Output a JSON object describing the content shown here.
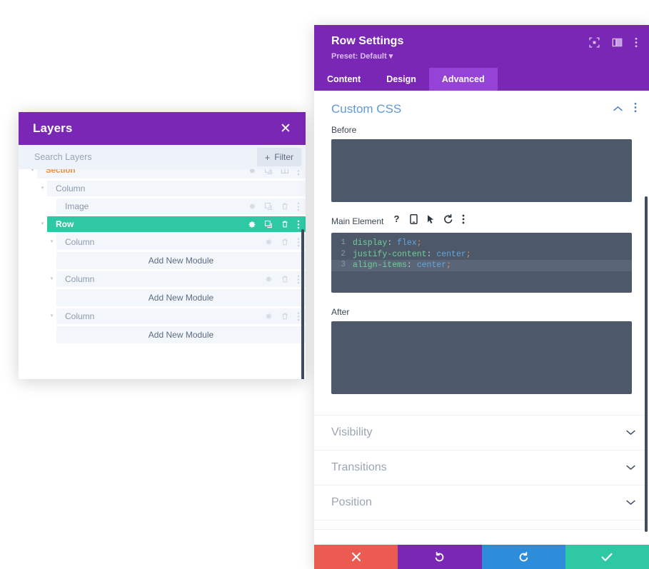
{
  "layers_panel": {
    "title": "Layers",
    "close_label": "✕",
    "search": {
      "placeholder": "Search Layers",
      "value": ""
    },
    "filter_button": {
      "plus": "+",
      "label": "Filter"
    },
    "rows": [
      {
        "label": "Section",
        "type": "section",
        "indent": 0,
        "caret": "▾",
        "icons": [
          "gear-icon",
          "duplicate-icon",
          "column-icon",
          "dots-icon"
        ]
      },
      {
        "label": "Column",
        "type": "plain",
        "indent": 1,
        "caret": "▾",
        "icons": []
      },
      {
        "label": "Image",
        "type": "plain",
        "indent": 2,
        "caret": "",
        "icons": [
          "gear-icon",
          "duplicate-icon",
          "trash-icon",
          "dots-icon"
        ]
      },
      {
        "label": "Row",
        "type": "selected",
        "indent": 1,
        "caret": "▾",
        "icons": [
          "gear-icon",
          "duplicate-icon",
          "trash-icon",
          "dots-icon"
        ]
      },
      {
        "label": "Column",
        "type": "plain",
        "indent": 2,
        "caret": "▾",
        "icons": [
          "gear-icon",
          "trash-icon",
          "dots-icon"
        ]
      },
      {
        "label": "Add New Module",
        "type": "module",
        "indent": 3
      },
      {
        "label": "Column",
        "type": "plain",
        "indent": 2,
        "caret": "▾",
        "icons": [
          "gear-icon",
          "trash-icon",
          "dots-icon"
        ]
      },
      {
        "label": "Add New Module",
        "type": "module",
        "indent": 3
      },
      {
        "label": "Column",
        "type": "plain",
        "indent": 2,
        "caret": "▾",
        "icons": [
          "gear-icon",
          "trash-icon",
          "dots-icon"
        ]
      },
      {
        "label": "Add New Module",
        "type": "module",
        "indent": 3
      }
    ]
  },
  "settings_panel": {
    "title": "Row Settings",
    "preset": "Preset: Default ▾",
    "header_icons": [
      "focus-icon",
      "layout-panel-icon",
      "dots-icon"
    ],
    "tabs": [
      {
        "label": "Content",
        "active": false
      },
      {
        "label": "Design",
        "active": false
      },
      {
        "label": "Advanced",
        "active": true
      }
    ],
    "custom_css": {
      "title": "Custom CSS",
      "collapse_icon": "chevron-up-icon",
      "menu_icon": "dots-icon",
      "before": {
        "label": "Before",
        "value": ""
      },
      "main_element": {
        "label": "Main Element",
        "icons": [
          "help-icon",
          "mobile-icon",
          "cursor-icon",
          "reset-icon",
          "dots-icon"
        ],
        "code_lines": [
          {
            "n": "1",
            "property": "display",
            "value": "flex",
            "active": false
          },
          {
            "n": "2",
            "property": "justify-content",
            "value": "center",
            "active": false
          },
          {
            "n": "3",
            "property": "align-items",
            "value": "center",
            "active": true
          }
        ]
      },
      "after": {
        "label": "After",
        "value": ""
      }
    },
    "accordions": [
      {
        "label": "Visibility",
        "icon": "chevron-down-icon"
      },
      {
        "label": "Transitions",
        "icon": "chevron-down-icon"
      },
      {
        "label": "Position",
        "icon": "chevron-down-icon"
      }
    ],
    "actions": [
      {
        "name": "cancel-button",
        "icon": "close-icon",
        "color": "#ec5b52"
      },
      {
        "name": "undo-button",
        "icon": "undo-icon",
        "color": "#7b27b5"
      },
      {
        "name": "redo-button",
        "icon": "redo-icon",
        "color": "#2d8ddb"
      },
      {
        "name": "save-button",
        "icon": "checkmark-icon",
        "color": "#2fc8a5"
      }
    ]
  },
  "colors": {
    "brand_purple": "#7b27b5",
    "tab_active": "#9542d6",
    "teal": "#2fc8a5",
    "code_bg": "#4d5969",
    "accent_blue": "#5f9ad1",
    "section_orange": "#ed8f3b"
  }
}
